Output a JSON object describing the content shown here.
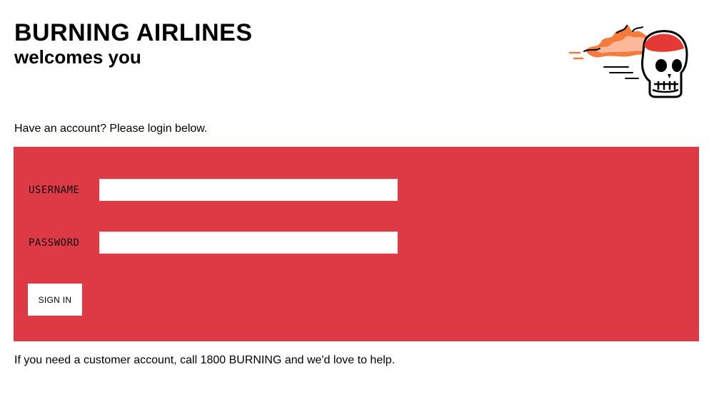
{
  "header": {
    "title": "BURNING AIRLINES",
    "subtitle": "welcomes you",
    "logo_icon": "flaming-skull-icon"
  },
  "intro": {
    "text": "Have an account? Please login below."
  },
  "login_form": {
    "panel_color": "#de3a45",
    "username_label": "USERNAME",
    "username_value": "",
    "password_label": "PASSWORD",
    "password_value": "",
    "submit_label": "SIGN IN"
  },
  "footer": {
    "help_text": "If you need a customer account, call 1800 BURNING and we'd love to help."
  }
}
